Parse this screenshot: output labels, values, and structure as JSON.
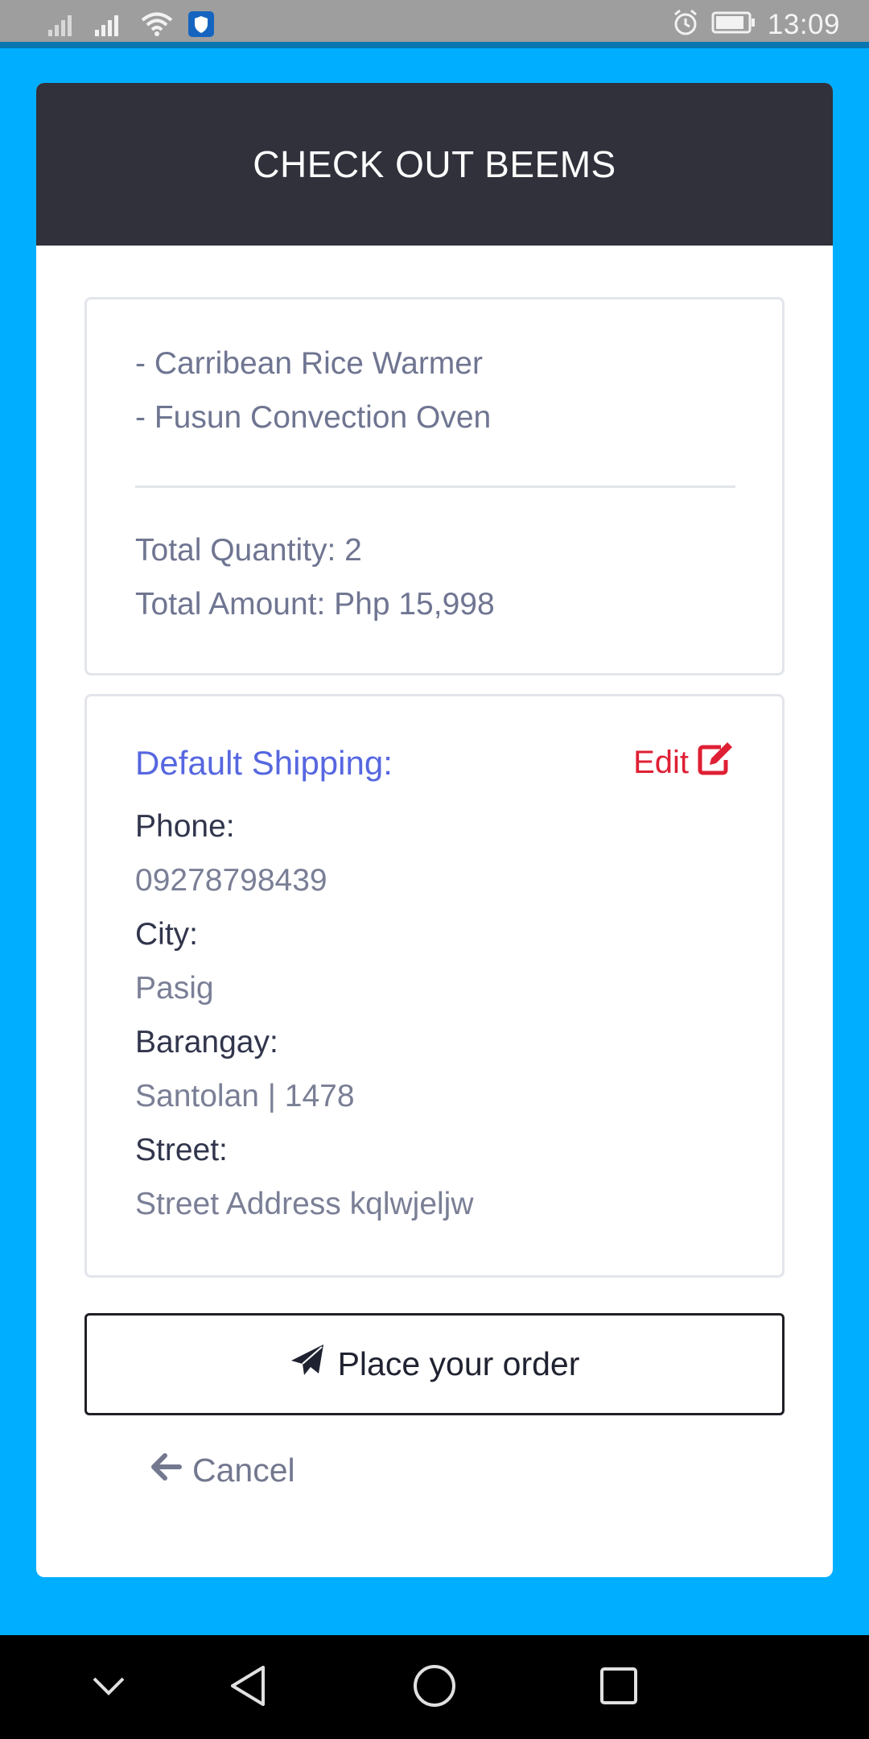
{
  "status_bar": {
    "time": "13:09",
    "icons": [
      "signal-icon",
      "signal-icon",
      "wifi-icon",
      "shield-icon",
      "alarm-icon",
      "battery-icon"
    ]
  },
  "header": {
    "title": "CHECK OUT BEEMS"
  },
  "order_summary": {
    "items": [
      "- Carribean Rice Warmer",
      "- Fusun Convection Oven"
    ],
    "total_quantity": "Total Quantity: 2",
    "total_amount": "Total Amount: Php 15,998"
  },
  "shipping": {
    "title": "Default Shipping:",
    "edit_label": "Edit",
    "phone_label": "Phone:",
    "phone_value": "09278798439",
    "city_label": "City:",
    "city_value": "Pasig",
    "barangay_label": "Barangay:",
    "barangay_value": "Santolan | 1478",
    "street_label": "Street:",
    "street_value": "Street Address kqlwjeljw"
  },
  "actions": {
    "place_order_label": "Place your order",
    "cancel_label": "Cancel"
  },
  "colors": {
    "background": "#00aeff",
    "header": "#30313b",
    "accent": "#5667e0",
    "edit": "#df1f34"
  },
  "nav": {
    "icons": [
      "chevron-down-icon",
      "back-icon",
      "home-icon",
      "recents-icon"
    ]
  }
}
